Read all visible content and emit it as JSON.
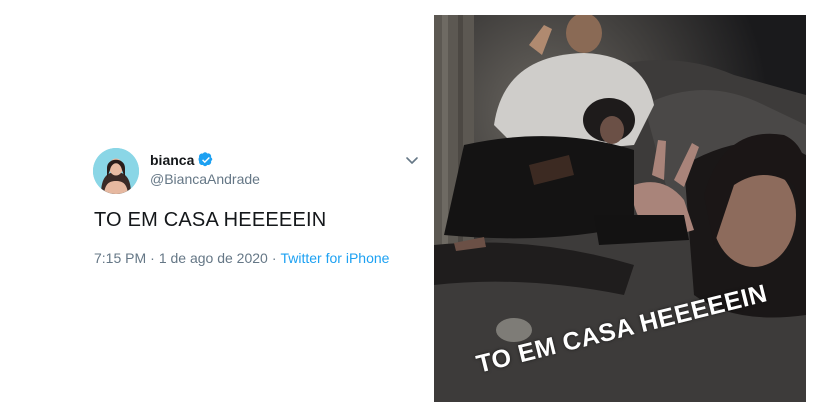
{
  "tweet": {
    "display_name": "bianca",
    "handle": "@BiancaAndrade",
    "text": "TO EM CASA HEEEEEIN",
    "time": "7:15 PM",
    "separator": "·",
    "date": "1 de ago de 2020",
    "source": "Twitter for iPhone",
    "verified": true
  },
  "photo": {
    "caption": "TO EM CASA HEEEEEIN"
  },
  "colors": {
    "accent": "#1da1f2",
    "secondary_text": "#657786",
    "primary_text": "#14171a"
  },
  "icons": {
    "verified": "verified-badge-icon",
    "menu": "chevron-down-icon"
  }
}
